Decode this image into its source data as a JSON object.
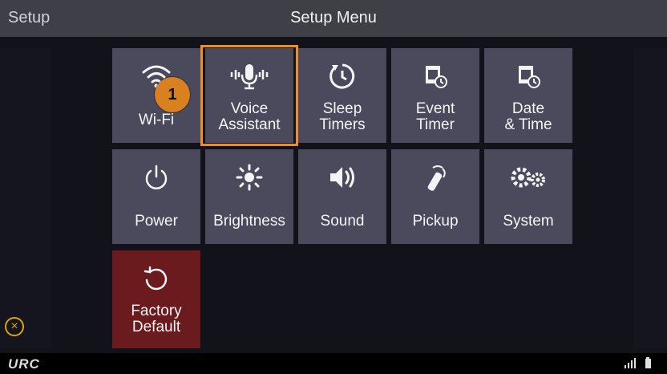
{
  "topbar": {
    "left_label": "Setup",
    "title": "Setup Menu"
  },
  "tiles": [
    {
      "label": "Wi-Fi",
      "icon": "wifi-icon"
    },
    {
      "label": "Voice\nAssistant",
      "icon": "microphone-icon"
    },
    {
      "label": "Sleep\nTimers",
      "icon": "sleep-timer-icon"
    },
    {
      "label": "Event\nTimer",
      "icon": "event-timer-icon"
    },
    {
      "label": "Date\n& Time",
      "icon": "calendar-clock-icon"
    },
    {
      "label": "Power",
      "icon": "power-icon"
    },
    {
      "label": "Brightness",
      "icon": "sun-icon"
    },
    {
      "label": "Sound",
      "icon": "speaker-icon"
    },
    {
      "label": "Pickup",
      "icon": "remote-pickup-icon"
    },
    {
      "label": "System",
      "icon": "gears-icon"
    },
    {
      "label": "Factory\nDefault",
      "icon": "reset-icon"
    }
  ],
  "badge": {
    "number": "1"
  },
  "bottombar": {
    "logo": "URC",
    "signal_icon": "signal-icon",
    "battery_icon": "battery-icon"
  },
  "close_button": {
    "icon": "close-icon",
    "glyph": "×"
  },
  "colors": {
    "tile": "#4a4a5c",
    "factory_tile": "#6b1a1e",
    "highlight": "#f28c1c",
    "badge": "#d98020"
  }
}
